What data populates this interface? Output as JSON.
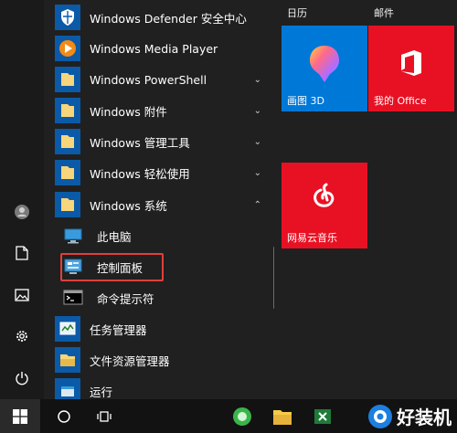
{
  "apps": [
    {
      "label": "Windows Defender 安全中心",
      "chevron": ""
    },
    {
      "label": "Windows Media Player",
      "chevron": ""
    },
    {
      "label": "Windows PowerShell",
      "chevron": "⌄"
    },
    {
      "label": "Windows 附件",
      "chevron": "⌄"
    },
    {
      "label": "Windows 管理工具",
      "chevron": "⌄"
    },
    {
      "label": "Windows 轻松使用",
      "chevron": "⌄"
    },
    {
      "label": "Windows 系统",
      "chevron": "⌃"
    },
    {
      "label": "此电脑",
      "chevron": ""
    },
    {
      "label": "控制面板",
      "chevron": ""
    },
    {
      "label": "命令提示符",
      "chevron": ""
    },
    {
      "label": "任务管理器",
      "chevron": ""
    },
    {
      "label": "文件资源管理器",
      "chevron": ""
    },
    {
      "label": "运行",
      "chevron": ""
    }
  ],
  "tiles": {
    "group_left": "日历",
    "group_right": "邮件",
    "paint3d": "画图 3D",
    "office": "我的 Office",
    "netease": "网易云音乐"
  },
  "colors": {
    "tile_blue": "#0078d7",
    "tile_red": "#e81123",
    "highlight": "#e0403c"
  },
  "watermark": "好装机"
}
